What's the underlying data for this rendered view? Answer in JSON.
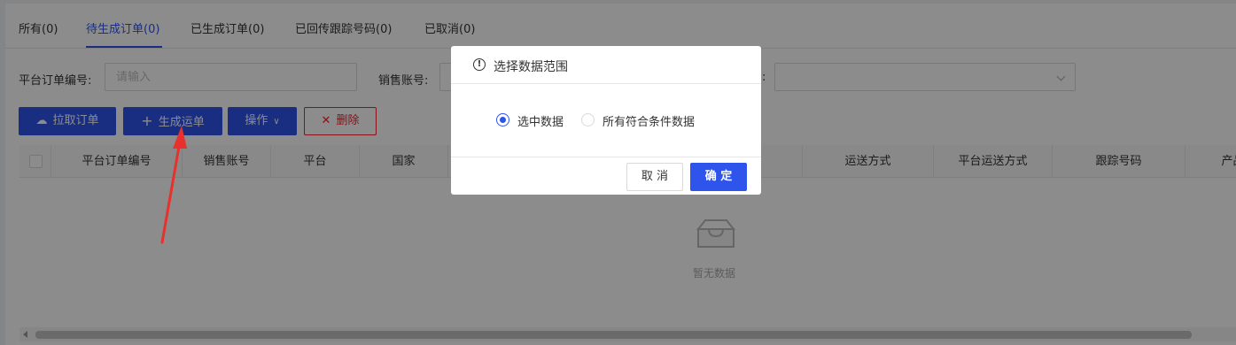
{
  "tabs": [
    {
      "label": "所有(0)"
    },
    {
      "label": "待生成订单(0)"
    },
    {
      "label": "已生成订单(0)"
    },
    {
      "label": "已回传跟踪号码(0)"
    },
    {
      "label": "已取消(0)"
    }
  ],
  "active_tab": 1,
  "filters": {
    "order_no_label": "平台订单编号:",
    "order_no_placeholder": "请输入",
    "account_label": "销售账号:",
    "third_label_tail": ":"
  },
  "toolbar": {
    "pull_label": "拉取订单",
    "generate_label": "生成运单",
    "operate_label": "操作",
    "delete_label": "删除"
  },
  "table": {
    "columns": [
      "平台订单编号",
      "销售账号",
      "平台",
      "国家",
      "运送方式",
      "平台运送方式",
      "跟踪号码",
      "产品数"
    ],
    "empty_text": "暂无数据"
  },
  "modal": {
    "title": "选择数据范围",
    "options": [
      {
        "label": "选中数据",
        "checked": true
      },
      {
        "label": "所有符合条件数据",
        "checked": false
      }
    ],
    "cancel_label": "取 消",
    "ok_label": "确 定"
  },
  "colors": {
    "primary": "#2f54eb",
    "danger": "#f5222d",
    "annotation_arrow": "#e8302c"
  }
}
